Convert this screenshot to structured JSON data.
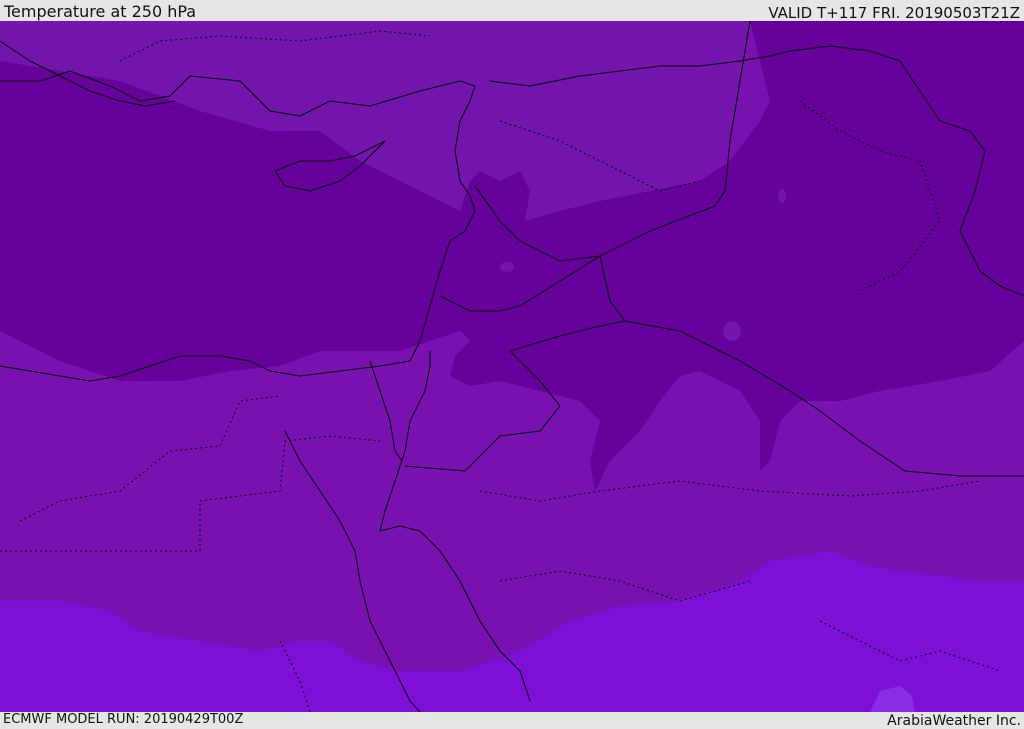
{
  "header": {
    "title": "Temperature at 250 hPa",
    "valid": "VALID T+117 FRI. 20190503T21Z"
  },
  "footer": {
    "model_run": "ECMWF MODEL RUN: 20190429T00Z",
    "credit": "ArabiaWeather Inc."
  },
  "map": {
    "region": "Eastern Mediterranean, Levant, Egypt and Arabia",
    "field": "250 hPa temperature shading",
    "colors": {
      "coldest_band": "#66019b",
      "cold_band": "#7a12b2",
      "mid_band": "#7a12b2",
      "warm_band": "#7d0fd6",
      "warmest_patch": "#8a2ee6",
      "coastline": "#000000",
      "border": "#000000"
    }
  }
}
